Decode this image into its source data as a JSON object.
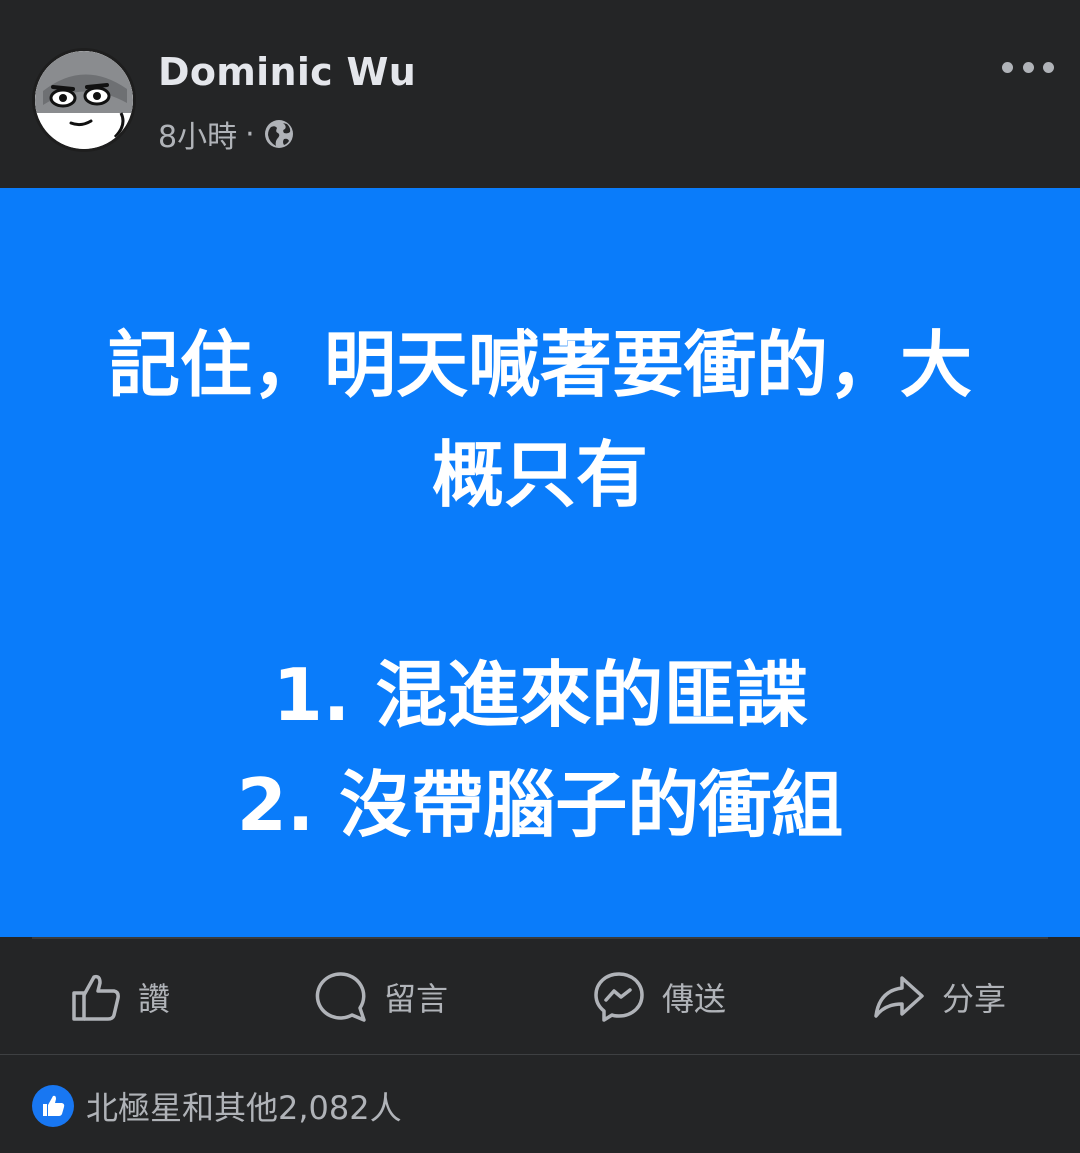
{
  "post": {
    "author": "Dominic Wu",
    "time": "8小時",
    "separator": "·",
    "privacy_icon": "globe-icon",
    "more_icon": "more-dots-icon",
    "background_color": "#0a7cfa",
    "text_lines": [
      "記住，明天喊著要衝的，大",
      "概只有",
      "",
      "1. 混進來的匪諜",
      "2. 沒帶腦子的衝組"
    ]
  },
  "actions": {
    "like": {
      "label": "讚",
      "icon": "thumbs-up-icon"
    },
    "comment": {
      "label": "留言",
      "icon": "comment-icon"
    },
    "send": {
      "label": "傳送",
      "icon": "messenger-icon"
    },
    "share": {
      "label": "分享",
      "icon": "share-arrow-icon"
    }
  },
  "reactions": {
    "summary": "北極星和其他2,082人",
    "icon": "like-reaction-icon",
    "accent": "#1877f2"
  }
}
